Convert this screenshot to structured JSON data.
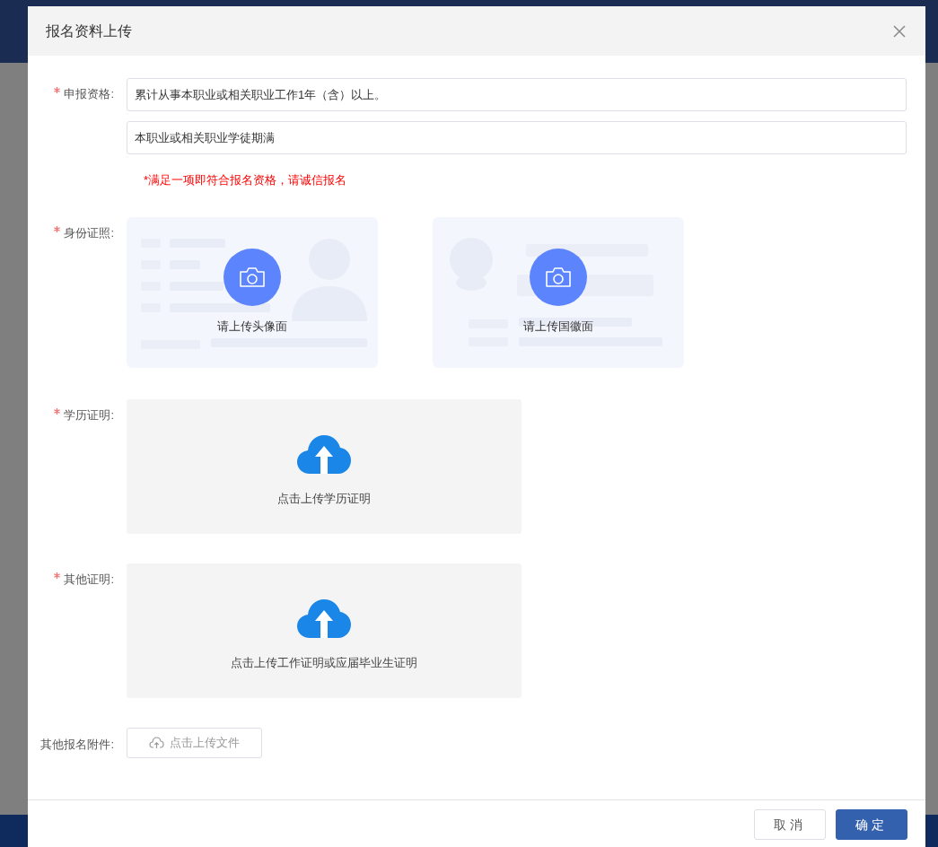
{
  "dialog": {
    "title": "报名资料上传"
  },
  "fields": [
    {
      "kind": "text_list",
      "label": "申报资格:",
      "required": true,
      "values": [
        "累计从事本职业或相关职业工作1年（含）以上。",
        "本职业或相关职业学徒期满"
      ],
      "note": "*满足一项即符合报名资格，请诚信报名"
    },
    {
      "kind": "id_cards",
      "label": "身份证照:",
      "required": true,
      "cards": [
        {
          "kind": "front",
          "caption": "请上传头像面"
        },
        {
          "kind": "back",
          "caption": "请上传国徽面"
        }
      ]
    },
    {
      "kind": "upload_area",
      "label": "学历证明:",
      "required": true,
      "caption": "点击上传学历证明"
    },
    {
      "kind": "upload_area",
      "label": "其他证明:",
      "required": true,
      "caption": "点击上传工作证明或应届毕业生证明"
    },
    {
      "kind": "upload_button",
      "label": "其他报名附件:",
      "required": false,
      "button": "点击上传文件"
    }
  ],
  "footer": {
    "buttons": [
      {
        "kind": "secondary",
        "label": "取消"
      },
      {
        "kind": "primary",
        "label": "确定"
      }
    ]
  }
}
